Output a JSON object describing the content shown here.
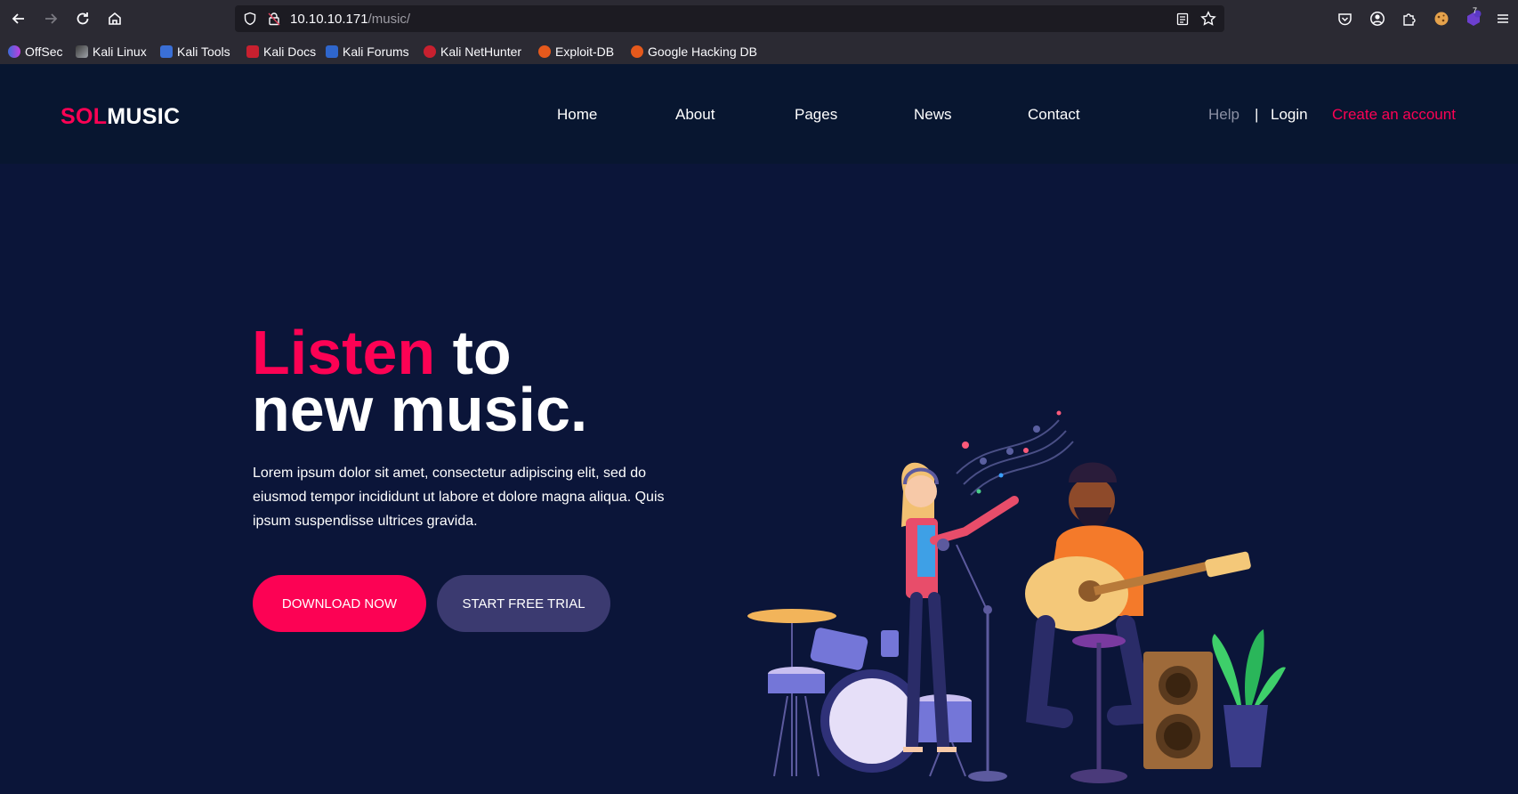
{
  "browser": {
    "url_host": "10.10.10.171",
    "url_path": "/music/",
    "extension_badge": "7"
  },
  "bookmarks": [
    {
      "label": "OffSec"
    },
    {
      "label": "Kali Linux"
    },
    {
      "label": "Kali Tools"
    },
    {
      "label": "Kali Docs"
    },
    {
      "label": "Kali Forums"
    },
    {
      "label": "Kali NetHunter"
    },
    {
      "label": "Exploit-DB"
    },
    {
      "label": "Google Hacking DB"
    }
  ],
  "site": {
    "logo_part1": "SOL",
    "logo_part2": "MUSIC",
    "nav": [
      "Home",
      "About",
      "Pages",
      "News",
      "Contact"
    ],
    "help": "Help",
    "separator": "|",
    "login": "Login",
    "create_account": "Create an account"
  },
  "hero": {
    "headline_accent": "Listen",
    "headline_rest": " to",
    "headline_line2": "new music.",
    "lead": "Lorem ipsum dolor sit amet, consectetur adipiscing elit, sed do eiusmod tempor incididunt ut labore et dolore magna aliqua. Quis ipsum suspendisse ultrices gravida.",
    "download_label": "DOWNLOAD NOW",
    "trial_label": "START FREE TRIAL"
  },
  "colors": {
    "accent": "#fc0254",
    "header_bg": "#081630",
    "hero_bg": "#0b1539",
    "secondary_button": "#3b3a70"
  }
}
